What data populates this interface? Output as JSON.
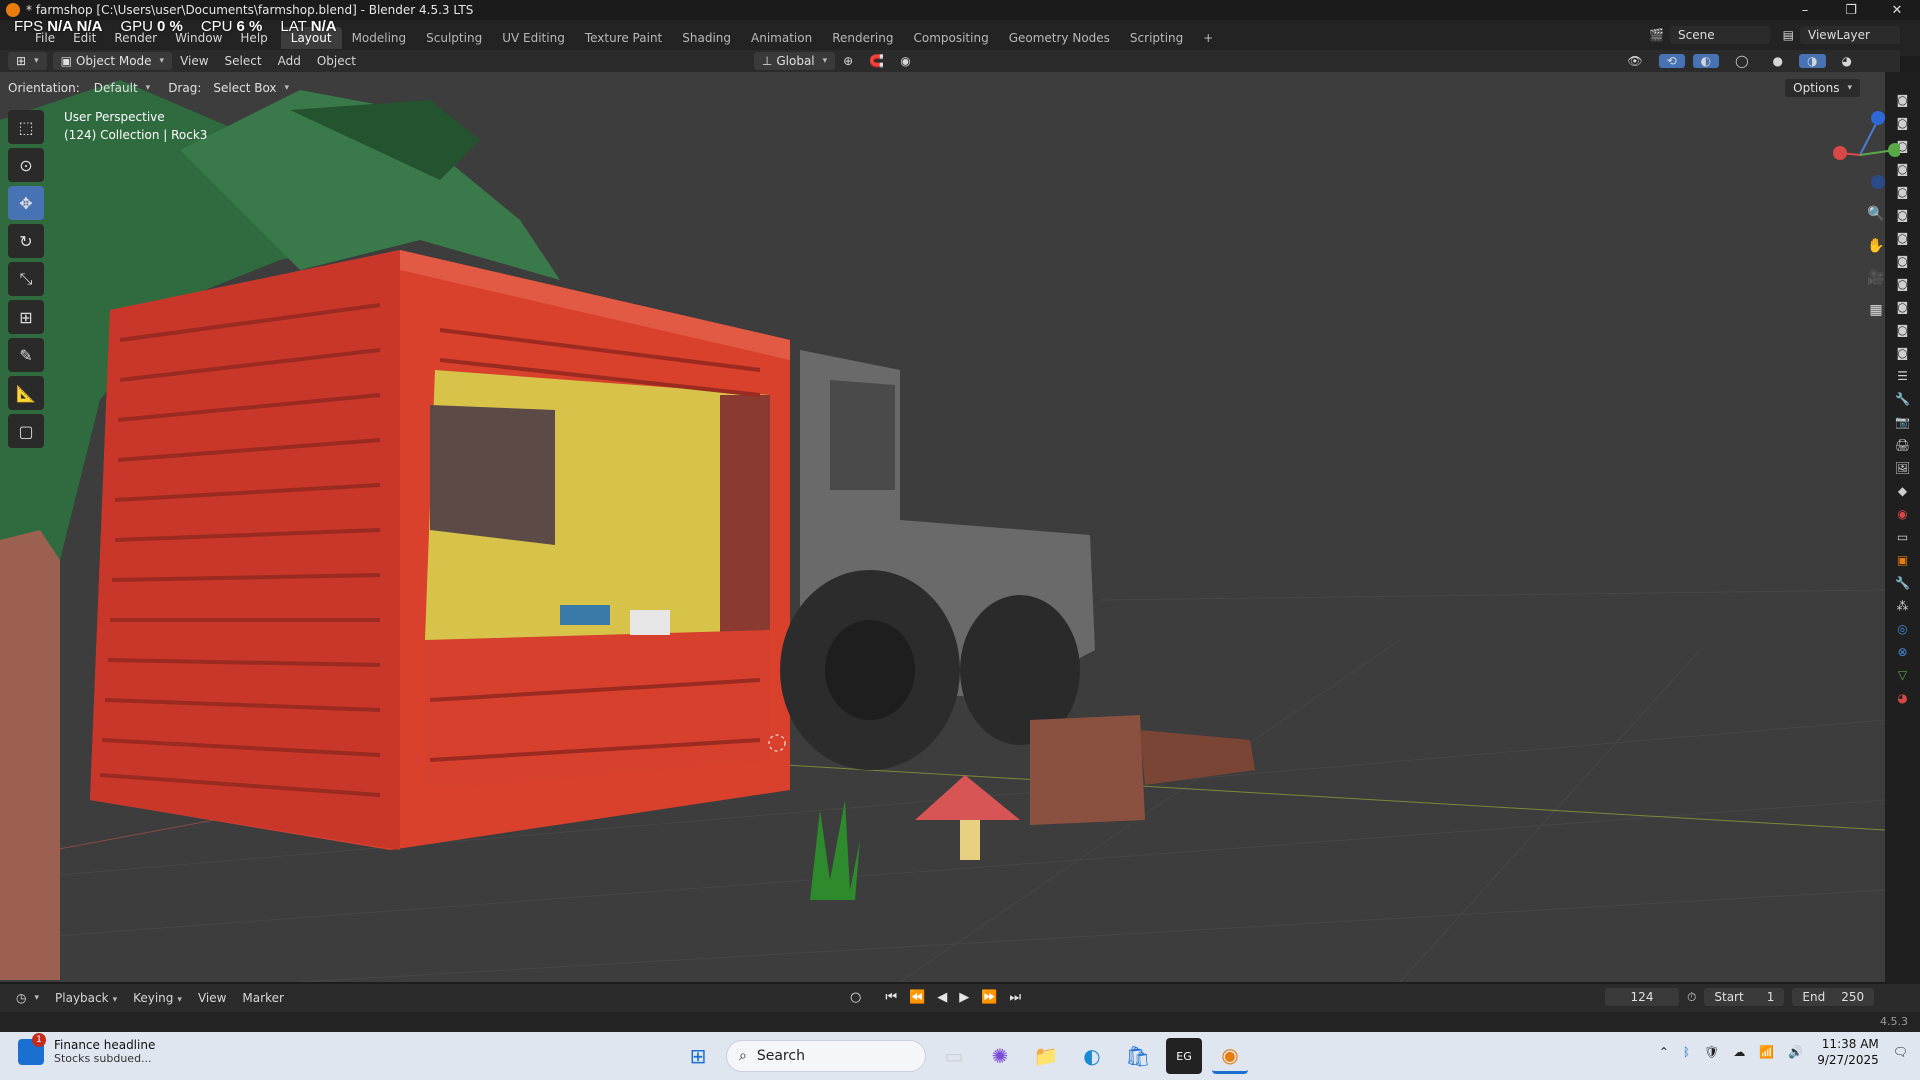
{
  "window": {
    "title": "* farmshop [C:\\Users\\user\\Documents\\farmshop.blend] - Blender 4.5.3 LTS",
    "controls": [
      "–",
      "❐",
      "✕"
    ]
  },
  "stats": [
    {
      "label": "FPS",
      "value": "N/A  N/A"
    },
    {
      "label": "GPU",
      "value": "0 %"
    },
    {
      "label": "CPU",
      "value": "6 %"
    },
    {
      "label": "LAT",
      "value": "N/A"
    }
  ],
  "menus": [
    "File",
    "Edit",
    "Render",
    "Window",
    "Help"
  ],
  "workspaces": [
    "Layout",
    "Modeling",
    "Sculpting",
    "UV Editing",
    "Texture Paint",
    "Shading",
    "Animation",
    "Rendering",
    "Compositing",
    "Geometry Nodes",
    "Scripting"
  ],
  "active_workspace": "Layout",
  "scene": "Scene",
  "view_layer": "ViewLayer",
  "header": {
    "mode": "Object Mode",
    "menus": [
      "View",
      "Select",
      "Add",
      "Object"
    ],
    "transform": "Global"
  },
  "tool_header": {
    "orientation_label": "Orientation:",
    "orientation": "Default",
    "drag_label": "Drag:",
    "drag": "Select Box",
    "options": "Options"
  },
  "viewport": {
    "line1": "User Perspective",
    "line2": "(124) Collection | Rock3"
  },
  "timeline": {
    "menus": [
      "Playback",
      "Keying",
      "View",
      "Marker"
    ],
    "current_frame": "124",
    "start_label": "Start",
    "start": "1",
    "end_label": "End",
    "end": "250"
  },
  "version": "4.5.3",
  "taskbar": {
    "news_title": "Finance headline",
    "news_sub": "Stocks subdued...",
    "badge": "1",
    "search": "Search",
    "time": "11:38 AM",
    "date": "9/27/2025"
  }
}
